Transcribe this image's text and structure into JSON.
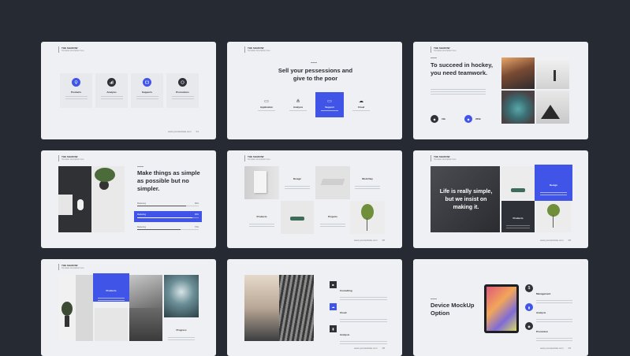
{
  "slides": {
    "s1": {
      "head_title": "THE SHADOW",
      "head_sub": "Template description here",
      "features": [
        {
          "label": "Products"
        },
        {
          "label": "Analysis"
        },
        {
          "label": "Supports"
        },
        {
          "label": "Promotions"
        }
      ],
      "footer": "www.yourwebsite.com",
      "page": "01"
    },
    "s2": {
      "head_title": "THE SHADOW",
      "head_sub": "Template description here",
      "title": "Sell your pessessions and give to the poor",
      "items": [
        {
          "label": "Application"
        },
        {
          "label": "Analysis"
        },
        {
          "label": "Support"
        },
        {
          "label": "Cloud"
        }
      ]
    },
    "s3": {
      "head_title": "THE SHADOW",
      "head_sub": "Template description here",
      "title": "To succeed in hockey, you need teamwork.",
      "stat1": "10k",
      "stat2": "200k"
    },
    "s4": {
      "head_title": "THE SHADOW",
      "head_sub": "Template description here",
      "title": "Make things as simple as possible but no simpler.",
      "bars": [
        {
          "label": "Marketing",
          "value": "80%",
          "level": 0.8
        },
        {
          "label": "Marketing",
          "value": "90%",
          "level": 0.9
        },
        {
          "label": "Marketing",
          "value": "70%",
          "level": 0.7
        }
      ]
    },
    "s5": {
      "head_title": "THE SHADOW",
      "head_sub": "Template description here",
      "cells": [
        "Design",
        "Work Day",
        "Products",
        "Projects"
      ],
      "footer": "www.yourwebsite.com",
      "page": "05"
    },
    "s6": {
      "head_title": "THE SHADOW",
      "head_sub": "Template description here",
      "quote": "Life is really simple, but we insist on making it.",
      "box1": "Design",
      "box2": "Products",
      "footer": "www.yourwebsite.com",
      "page": "06"
    },
    "s7": {
      "head_title": "THE SHADOW",
      "head_sub": "Template description here",
      "box1": "Products",
      "box2": "Progress"
    },
    "s8": {
      "items": [
        {
          "label": "Consulting"
        },
        {
          "label": "Cloud"
        },
        {
          "label": "Analysis"
        }
      ],
      "footer": "www.yourwebsite.com",
      "page": "08"
    },
    "s9": {
      "title": "Device MockUp Option",
      "items": [
        {
          "label": "Management"
        },
        {
          "label": "Analysis"
        },
        {
          "label": "Promotion"
        }
      ],
      "footer": "www.yourwebsite.com",
      "page": "09"
    }
  },
  "colors": {
    "accent": "#4054e8",
    "background": "#262a32",
    "slide": "#eef0f3",
    "dark_icon": "#2e3138"
  },
  "icons": [
    "lightbulb-icon",
    "chart-icon",
    "support-icon",
    "megaphone-icon",
    "cloud-icon",
    "dollar-icon",
    "monitor-icon",
    "briefcase-icon"
  ]
}
